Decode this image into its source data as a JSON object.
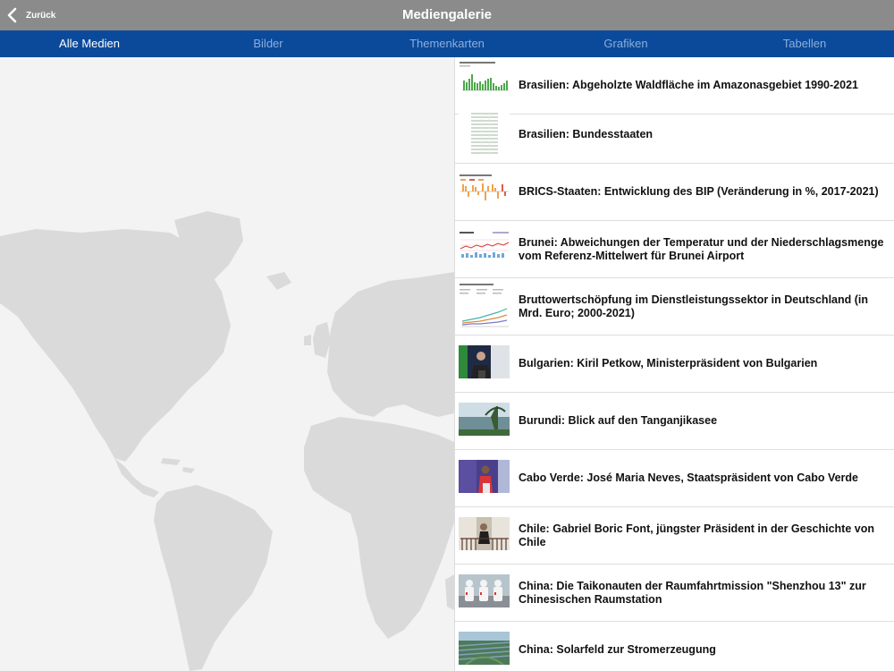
{
  "header": {
    "back_label": "Zurück",
    "title": "Mediengalerie"
  },
  "tabs": [
    {
      "label": "Alle Medien",
      "active": true
    },
    {
      "label": "Bilder",
      "active": false
    },
    {
      "label": "Themenkarten",
      "active": false
    },
    {
      "label": "Grafiken",
      "active": false
    },
    {
      "label": "Tabellen",
      "active": false
    }
  ],
  "colors": {
    "header_bg": "#8b8b8b",
    "tabbar_bg": "#0b4a9a",
    "tab_active": "#ffffff",
    "tab_inactive": "#8aaedc",
    "map_land": "#dadada",
    "map_bg": "#f3f3f3"
  },
  "map": {
    "icon": "world-map"
  },
  "media": [
    {
      "title": "Brasilien: Abgeholzte Waldfläche im Amazonasgebiet 1990-2021",
      "thumb": "bar-chart-thumb"
    },
    {
      "title": "Brasilien: Bundesstaaten",
      "thumb": "table-thumb"
    },
    {
      "title": "BRICS-Staaten: Entwicklung des BIP (Veränderung in %, 2017-2021)",
      "thumb": "bar-chart-thumb"
    },
    {
      "title": "Brunei: Abweichungen der Temperatur und der Niederschlagsmenge vom Referenz-Mittelwert für Brunei Airport",
      "thumb": "climate-chart-thumb"
    },
    {
      "title": "Bruttowertschöpfung im Dienstleistungssektor in Deutschland (in Mrd. Euro; 2000-2021)",
      "thumb": "line-chart-thumb"
    },
    {
      "title": "Bulgarien: Kiril Petkow, Ministerpräsident von Bulgarien",
      "thumb": "photo-thumb"
    },
    {
      "title": "Burundi: Blick auf den Tanganjikasee",
      "thumb": "photo-thumb"
    },
    {
      "title": "Cabo Verde: José Maria Neves, Staatspräsident von Cabo Verde",
      "thumb": "photo-thumb"
    },
    {
      "title": "Chile: Gabriel Boric Font, jüngster Präsident in der Geschichte von Chile",
      "thumb": "photo-thumb"
    },
    {
      "title": "China: Die Taikonauten der Raumfahrtmission \"Shenzhou 13\" zur Chinesischen Raumstation",
      "thumb": "photo-thumb"
    },
    {
      "title": "China: Solarfeld zur Stromerzeugung",
      "thumb": "photo-thumb"
    }
  ]
}
